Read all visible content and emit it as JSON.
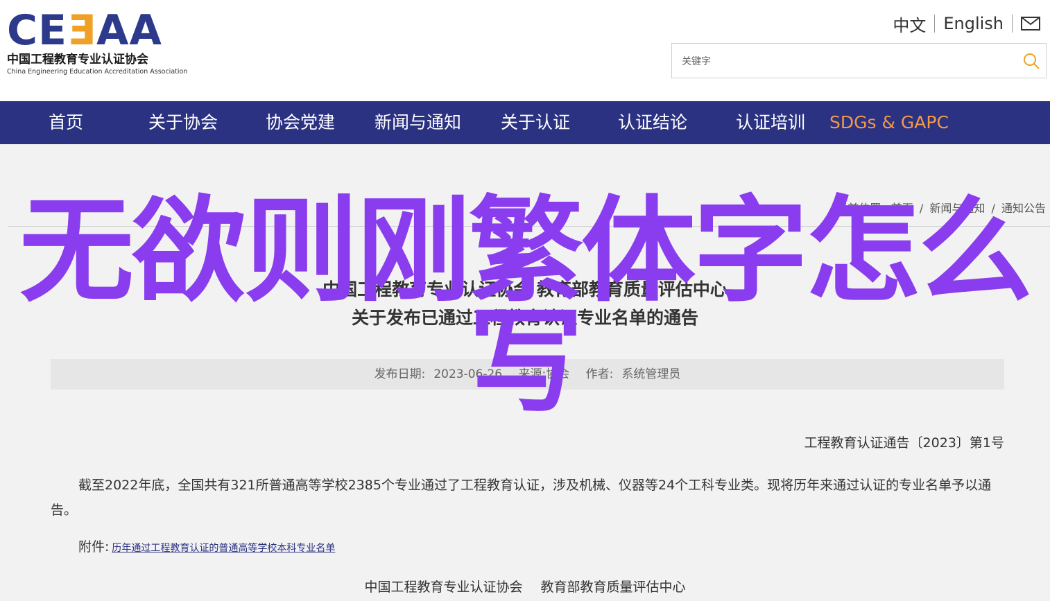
{
  "header": {
    "logo": {
      "mark": "CEEAA",
      "cn_name": "中国工程教育专业认证协会",
      "en_name": "China Engineering Education Accreditation Association"
    },
    "lang_cn": "中文",
    "lang_en": "English",
    "mail_icon": "mail-icon",
    "search": {
      "placeholder": "关键字",
      "icon": "search-icon"
    }
  },
  "nav": {
    "items": [
      "首页",
      "关于协会",
      "协会党建",
      "新闻与通知",
      "关于认证",
      "认证结论",
      "认证培训",
      "SDGs & GAPC"
    ]
  },
  "breadcrumb": {
    "label": "当前位置:",
    "items": [
      "首页",
      "新闻与通知",
      "通知公告"
    ],
    "separator": "/"
  },
  "article": {
    "title_line1": "中国工程教育专业认证协会 教育部教育质量评估中心",
    "title_line2": "关于发布已通过工程教育认证专业名单的通告",
    "meta": {
      "date_label": "发布日期:",
      "date": "2023-06-26",
      "source": "来源:协会",
      "author_label": "作者:",
      "author": "系统管理员"
    },
    "doc_number": "工程教育认证通告〔2023〕第1号",
    "body": "截至2022年底，全国共有321所普通高等学校2385个专业通过了工程教育认证，涉及机械、仪器等24个工科专业类。现将历年来通过认证的专业名单予以通告。",
    "attachment_label": "附件:",
    "attachment_link": "历年通过工程教育认证的普通高等学校本科专业名单",
    "signatories": [
      "中国工程教育专业认证协会",
      "教育部教育质量评估中心"
    ]
  },
  "overlay_text": "无欲则刚繁体字怎么写",
  "colors": {
    "nav_bg": "#2b3282",
    "nav_accent": "#f29a4a",
    "overlay": "#8a3dee",
    "logo_blue": "#2d3a8c",
    "logo_orange": "#f0a024"
  }
}
